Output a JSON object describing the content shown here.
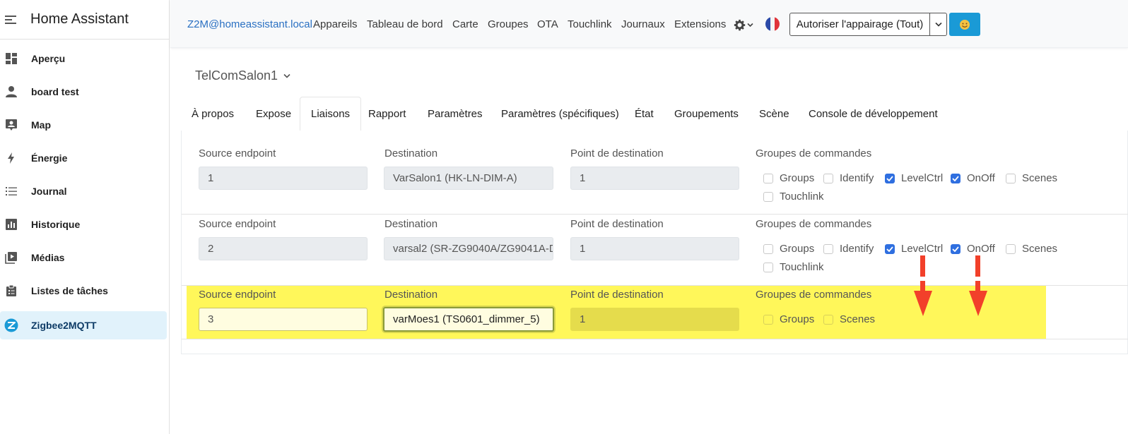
{
  "sidebar": {
    "title": "Home Assistant",
    "items": [
      {
        "label": "Aperçu",
        "icon": "dashboard-icon"
      },
      {
        "label": "board test",
        "icon": "person-icon"
      },
      {
        "label": "Map",
        "icon": "map-icon"
      },
      {
        "label": "Énergie",
        "icon": "lightning-icon"
      },
      {
        "label": "Journal",
        "icon": "list-icon"
      },
      {
        "label": "Historique",
        "icon": "chart-icon"
      },
      {
        "label": "Médias",
        "icon": "media-icon"
      },
      {
        "label": "Listes de tâches",
        "icon": "clipboard-icon"
      },
      {
        "label": "Zigbee2MQTT",
        "icon": "zigbee-icon",
        "active": true
      }
    ]
  },
  "nav": {
    "brand": "Z2M@homeassistant.local",
    "links": [
      "Appareils",
      "Tableau de bord",
      "Carte",
      "Groupes",
      "OTA",
      "Touchlink",
      "Journaux",
      "Extensions"
    ],
    "pair_button": "Autoriser l'appairage (Tout)",
    "accent": "#1a9ad6"
  },
  "device": {
    "name": "TelComSalon1"
  },
  "tabs": [
    "À propos",
    "Expose",
    "Liaisons",
    "Rapport",
    "Paramètres",
    "Paramètres (spécifiques)",
    "État",
    "Groupements",
    "Scène",
    "Console de développement"
  ],
  "active_tab": "Liaisons",
  "labels": {
    "source": "Source endpoint",
    "destination": "Destination",
    "dest_point": "Point de destination",
    "groups": "Groupes de commandes"
  },
  "bindings": [
    {
      "source": "1",
      "destination": "VarSalon1 (HK-LN-DIM-A)",
      "dest_point": "1",
      "clusters": [
        {
          "label": "Groups",
          "checked": false
        },
        {
          "label": "Identify",
          "checked": false
        },
        {
          "label": "LevelCtrl",
          "checked": true
        },
        {
          "label": "OnOff",
          "checked": true
        },
        {
          "label": "Scenes",
          "checked": false
        },
        {
          "label": "Touchlink",
          "checked": false
        }
      ]
    },
    {
      "source": "2",
      "destination": "varsal2 (SR-ZG9040A/ZG9041A-D",
      "dest_point": "1",
      "clusters": [
        {
          "label": "Groups",
          "checked": false
        },
        {
          "label": "Identify",
          "checked": false
        },
        {
          "label": "LevelCtrl",
          "checked": true
        },
        {
          "label": "OnOff",
          "checked": true
        },
        {
          "label": "Scenes",
          "checked": false
        },
        {
          "label": "Touchlink",
          "checked": false
        }
      ]
    },
    {
      "source": "3",
      "destination": "varMoes1 (TS0601_dimmer_5)",
      "dest_point": "1",
      "clusters": [
        {
          "label": "Groups",
          "checked": false
        },
        {
          "label": "Scenes",
          "checked": false
        }
      ]
    }
  ],
  "highlight_color": "#fff75a",
  "arrow_color": "#f2402a"
}
